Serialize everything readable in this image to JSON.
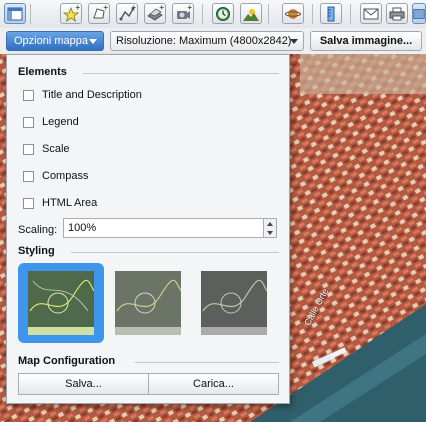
{
  "toolbar": {
    "icons": [
      "layout-icon",
      "add-placemark-icon",
      "add-polygon-icon",
      "add-path-icon",
      "add-overlay-icon",
      "add-tour-icon",
      "historical-imagery-icon",
      "sunlight-icon",
      "planets-icon",
      "ruler-icon",
      "email-icon",
      "print-icon",
      "save-image-icon"
    ]
  },
  "map_options": {
    "label": "Opzioni mappa"
  },
  "resolution": {
    "value": "Risoluzione: Maximum (4800x2842)"
  },
  "save_image": {
    "label": "Salva immagine..."
  },
  "panel": {
    "elements_title": "Elements",
    "checkboxes": [
      {
        "label": "Title and Description",
        "checked": false
      },
      {
        "label": "Legend",
        "checked": false
      },
      {
        "label": "Scale",
        "checked": false
      },
      {
        "label": "Compass",
        "checked": false
      },
      {
        "label": "HTML Area",
        "checked": false
      }
    ],
    "scaling_label": "Scaling:",
    "scaling_value": "100%",
    "styling_title": "Styling",
    "styles_selected_index": 0,
    "map_config_title": "Map Configuration",
    "save_label": "Salva...",
    "load_label": "Carica..."
  },
  "map": {
    "street_label": "Calle Orte"
  },
  "colors": {
    "accent": "#3d95ec",
    "button_blue": "#2f6fc2",
    "water": "#2f5f6a"
  }
}
